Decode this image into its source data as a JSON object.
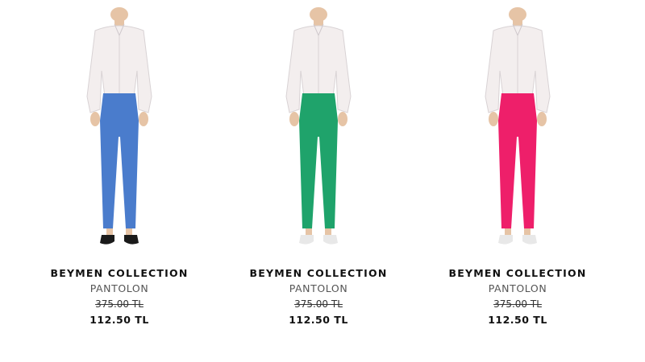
{
  "products": [
    {
      "brand": "BEYMEN COLLECTION",
      "type": "PANTOLON",
      "old_price": "375.00 TL",
      "price": "112.50 TL",
      "pants_color": "#4a7ccc",
      "shoe_color": "#1a1a1a"
    },
    {
      "brand": "BEYMEN COLLECTION",
      "type": "PANTOLON",
      "old_price": "375.00 TL",
      "price": "112.50 TL",
      "pants_color": "#1fa36b",
      "shoe_color": "#e8e8e8"
    },
    {
      "brand": "BEYMEN COLLECTION",
      "type": "PANTOLON",
      "old_price": "375.00 TL",
      "price": "112.50 TL",
      "pants_color": "#ee1f6a",
      "shoe_color": "#e8e8e8"
    }
  ]
}
